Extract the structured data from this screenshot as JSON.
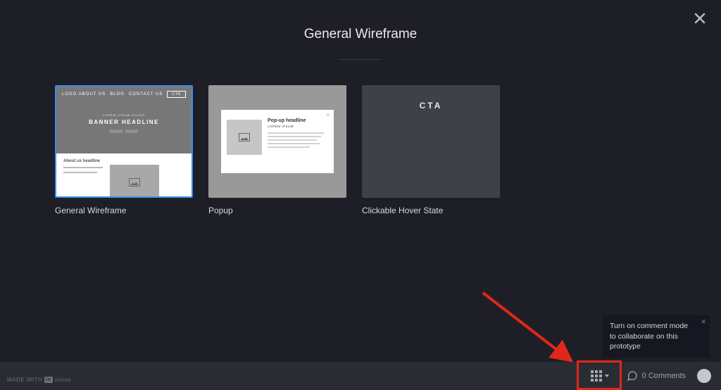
{
  "header": {
    "title": "General Wireframe"
  },
  "cards": [
    {
      "label": "General Wireframe",
      "content": {
        "logo": "LOGO",
        "nav_items": [
          "ABOUT US",
          "BLOG",
          "CONTACT US"
        ],
        "overline": "LOREM IPSUM DOLOR",
        "banner": "BANNER HEADLINE",
        "about_title": "About us headline"
      }
    },
    {
      "label": "Popup",
      "content": {
        "headline": "Pop-up headline",
        "subhead": "LOREM IPSUM"
      }
    },
    {
      "label": "Clickable Hover State",
      "content": {
        "text": "CTA"
      }
    }
  ],
  "bottombar": {
    "made_with_prefix": "MADE WITH",
    "brand_mark": "in",
    "brand_suffix": "vision",
    "comments_label": "0 Comments"
  },
  "tooltip": {
    "text": "Turn on comment mode to collaborate on this prototype"
  }
}
